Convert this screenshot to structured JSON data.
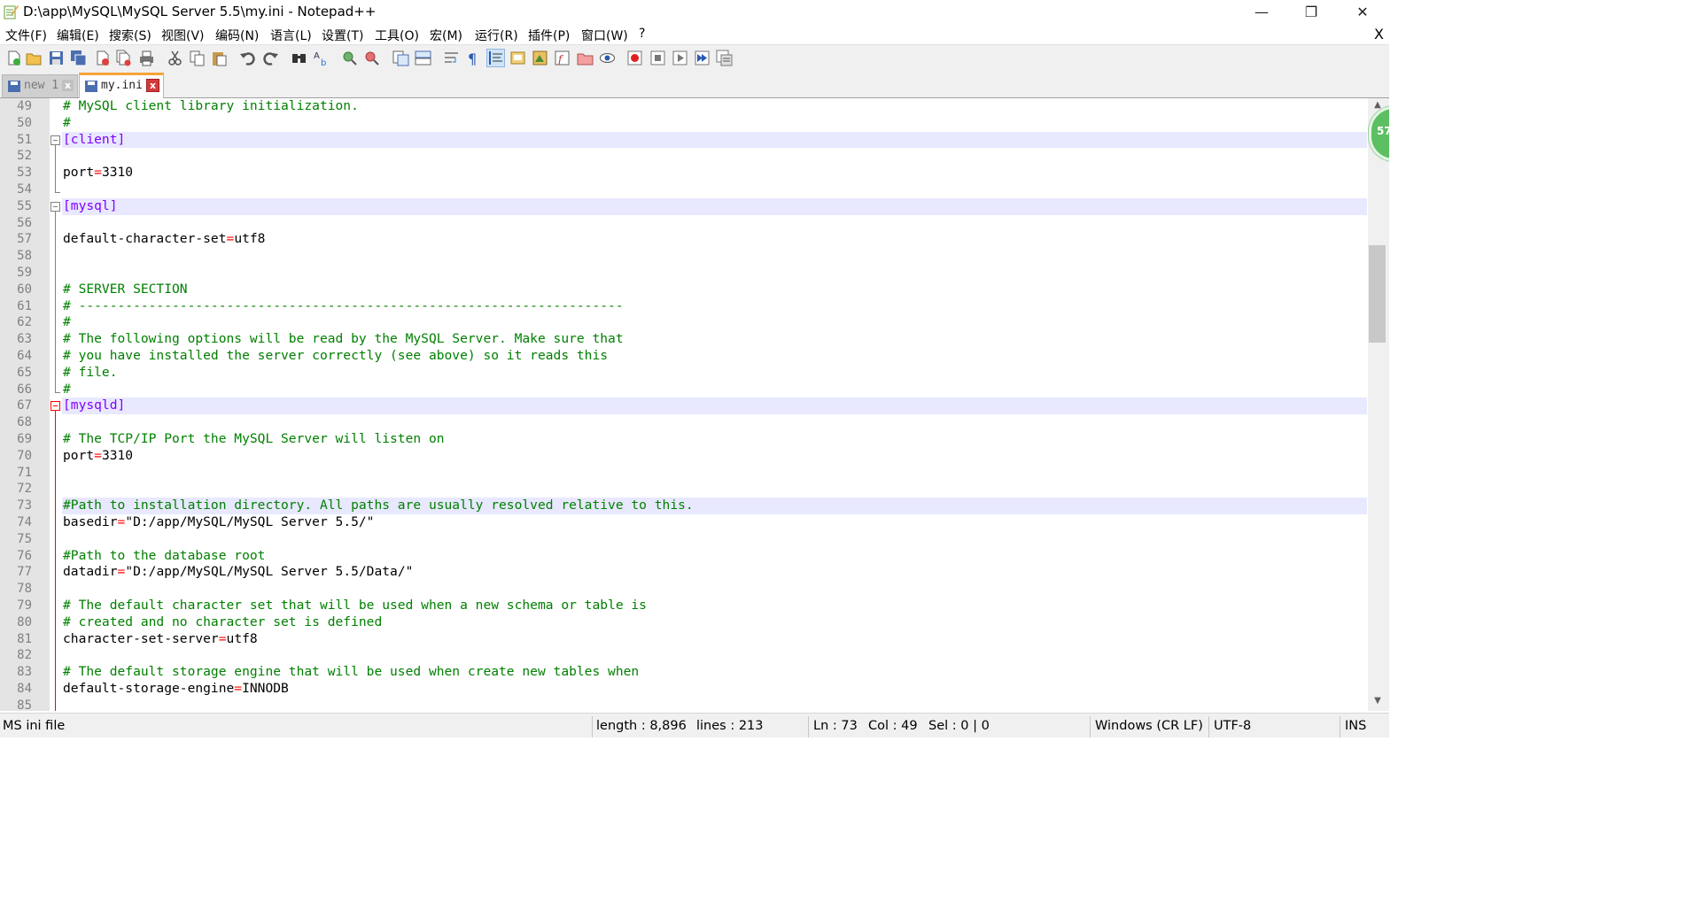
{
  "window": {
    "title": "D:\\app\\MySQL\\MySQL Server 5.5\\my.ini - Notepad++",
    "minimize_glyph": "—",
    "maximize_glyph": "❐",
    "close_glyph": "✕"
  },
  "menu": {
    "items": [
      "文件(F)",
      "编辑(E)",
      "搜索(S)",
      "视图(V)",
      "编码(N)",
      "语言(L)",
      "设置(T)",
      "工具(O)",
      "宏(M)",
      "运行(R)",
      "插件(P)",
      "窗口(W)",
      "?"
    ],
    "close_label": "X"
  },
  "tabs": [
    {
      "label": "new 1",
      "active": false,
      "close_glyph": "x"
    },
    {
      "label": "my.ini",
      "active": true,
      "close_glyph": "x"
    }
  ],
  "editor": {
    "lines": [
      {
        "n": "49",
        "text": "# MySQL client library initialization."
      },
      {
        "n": "50",
        "text": "#"
      },
      {
        "n": "51",
        "text": "[client]"
      },
      {
        "n": "52",
        "text": ""
      },
      {
        "n": "53",
        "text": "port=3310"
      },
      {
        "n": "54",
        "text": ""
      },
      {
        "n": "55",
        "text": "[mysql]"
      },
      {
        "n": "56",
        "text": ""
      },
      {
        "n": "57",
        "text": "default-character-set=utf8"
      },
      {
        "n": "58",
        "text": ""
      },
      {
        "n": "59",
        "text": ""
      },
      {
        "n": "60",
        "text": "# SERVER SECTION"
      },
      {
        "n": "61",
        "text": "# ----------------------------------------------------------------------"
      },
      {
        "n": "62",
        "text": "#"
      },
      {
        "n": "63",
        "text": "# The following options will be read by the MySQL Server. Make sure that"
      },
      {
        "n": "64",
        "text": "# you have installed the server correctly (see above) so it reads this"
      },
      {
        "n": "65",
        "text": "# file."
      },
      {
        "n": "66",
        "text": "#"
      },
      {
        "n": "67",
        "text": "[mysqld]"
      },
      {
        "n": "68",
        "text": ""
      },
      {
        "n": "69",
        "text": "# The TCP/IP Port the MySQL Server will listen on"
      },
      {
        "n": "70",
        "text": "port=3310"
      },
      {
        "n": "71",
        "text": ""
      },
      {
        "n": "72",
        "text": ""
      },
      {
        "n": "73",
        "text": "#Path to installation directory. All paths are usually resolved relative to this."
      },
      {
        "n": "74",
        "text": "basedir=\"D:/app/MySQL/MySQL Server 5.5/\""
      },
      {
        "n": "75",
        "text": ""
      },
      {
        "n": "76",
        "text": "#Path to the database root"
      },
      {
        "n": "77",
        "text": "datadir=\"D:/app/MySQL/MySQL Server 5.5/Data/\""
      },
      {
        "n": "78",
        "text": ""
      },
      {
        "n": "79",
        "text": "# The default character set that will be used when a new schema or table is"
      },
      {
        "n": "80",
        "text": "# created and no character set is defined"
      },
      {
        "n": "81",
        "text": "character-set-server=utf8"
      },
      {
        "n": "82",
        "text": ""
      },
      {
        "n": "83",
        "text": "# The default storage engine that will be used when create new tables when"
      },
      {
        "n": "84",
        "text": "default-storage-engine=INNODB"
      },
      {
        "n": "85",
        "text": ""
      }
    ],
    "current_line": "73",
    "scroll_badge": "57"
  },
  "statusbar": {
    "language": "MS ini file",
    "length": "length : 8,896",
    "lines": "lines : 213",
    "ln": "Ln : 73",
    "col": "Col : 49",
    "sel": "Sel : 0 | 0",
    "eol": "Windows (CR LF)",
    "encoding": "UTF-8",
    "mode": "INS"
  },
  "colors": {
    "comment": "#008000",
    "section": "#8000ff",
    "operator": "#ff0000",
    "current_line_bg": "#e8e8ff",
    "active_tab_accent": "#f6a43a"
  },
  "toolbar_icons": [
    "new-file-icon",
    "open-file-icon",
    "save-icon",
    "save-all-icon",
    "close-icon",
    "close-all-icon",
    "print-icon",
    "cut-icon",
    "copy-icon",
    "paste-icon",
    "undo-icon",
    "redo-icon",
    "find-icon",
    "replace-icon",
    "zoom-in-icon",
    "zoom-out-icon",
    "sync-vertical-icon",
    "sync-horizontal-icon",
    "word-wrap-icon",
    "show-all-chars-icon",
    "indent-guide-icon",
    "udl-icon",
    "doc-map-icon",
    "function-list-icon",
    "folder-workspace-icon",
    "monitoring-icon",
    "record-macro-icon",
    "stop-macro-icon",
    "play-macro-icon",
    "run-macro-multiple-icon",
    "save-macro-icon"
  ]
}
